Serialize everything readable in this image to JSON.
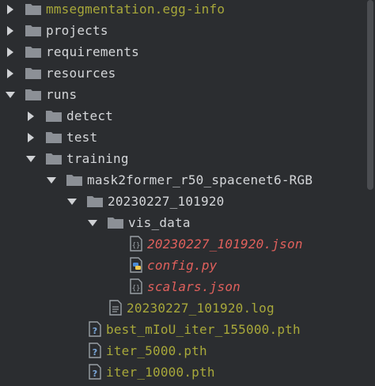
{
  "tree": {
    "rows": [
      {
        "label": "mmsegmentation.egg-info",
        "kind": "folder",
        "arrow": "right",
        "color": "excluded"
      },
      {
        "label": "projects",
        "kind": "folder",
        "arrow": "right",
        "color": "default"
      },
      {
        "label": "requirements",
        "kind": "folder",
        "arrow": "right",
        "color": "default"
      },
      {
        "label": "resources",
        "kind": "folder",
        "arrow": "right",
        "color": "default"
      },
      {
        "label": "runs",
        "kind": "folder",
        "arrow": "down",
        "color": "default"
      },
      {
        "label": "detect",
        "kind": "folder",
        "arrow": "right",
        "color": "default"
      },
      {
        "label": "test",
        "kind": "folder",
        "arrow": "right",
        "color": "default"
      },
      {
        "label": "training",
        "kind": "folder",
        "arrow": "down",
        "color": "default"
      },
      {
        "label": "mask2former_r50_spacenet6-RGB",
        "kind": "folder",
        "arrow": "down",
        "color": "default"
      },
      {
        "label": "20230227_101920",
        "kind": "folder",
        "arrow": "down",
        "color": "default"
      },
      {
        "label": "vis_data",
        "kind": "folder",
        "arrow": "down",
        "color": "default"
      },
      {
        "label": "20230227_101920.json",
        "kind": "json-file",
        "arrow": "none",
        "color": "error"
      },
      {
        "label": "config.py",
        "kind": "python-file",
        "arrow": "none",
        "color": "error"
      },
      {
        "label": "scalars.json",
        "kind": "json-file",
        "arrow": "none",
        "color": "error"
      },
      {
        "label": "20230227_101920.log",
        "kind": "log-file",
        "arrow": "none",
        "color": "excluded"
      },
      {
        "label": "best_mIoU_iter_155000.pth",
        "kind": "unknown-file",
        "arrow": "none",
        "color": "excluded"
      },
      {
        "label": "iter_5000.pth",
        "kind": "unknown-file",
        "arrow": "none",
        "color": "excluded"
      },
      {
        "label": "iter_10000.pth",
        "kind": "unknown-file",
        "arrow": "none",
        "color": "excluded"
      }
    ]
  },
  "colors": {
    "background": "#2b2d30",
    "default_text": "#d4d6d9",
    "excluded_text": "#a8a83a",
    "error_text": "#e0605c",
    "folder_icon": "#8c9096",
    "json_icon": "#9aa0a6",
    "python_blue": "#4a8bd6",
    "python_yellow": "#f2c94c",
    "unknown_icon": "#7aa7d9"
  }
}
